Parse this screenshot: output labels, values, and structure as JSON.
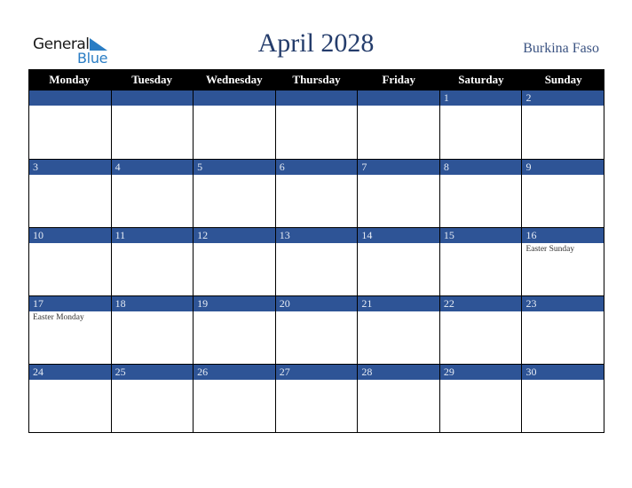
{
  "logo": {
    "word1": "General",
    "word2": "Blue",
    "icon": "triangle-flag-icon"
  },
  "header": {
    "title": "April 2028",
    "country": "Burkina Faso"
  },
  "colors": {
    "band": "#2e5496",
    "header_bg": "#000000",
    "title": "#243c6b",
    "logo_blue": "#2a7dc4"
  },
  "weekdays": [
    "Monday",
    "Tuesday",
    "Wednesday",
    "Thursday",
    "Friday",
    "Saturday",
    "Sunday"
  ],
  "weeks": [
    [
      {
        "day": ""
      },
      {
        "day": ""
      },
      {
        "day": ""
      },
      {
        "day": ""
      },
      {
        "day": ""
      },
      {
        "day": "1"
      },
      {
        "day": "2"
      }
    ],
    [
      {
        "day": "3"
      },
      {
        "day": "4"
      },
      {
        "day": "5"
      },
      {
        "day": "6"
      },
      {
        "day": "7"
      },
      {
        "day": "8"
      },
      {
        "day": "9"
      }
    ],
    [
      {
        "day": "10"
      },
      {
        "day": "11"
      },
      {
        "day": "12"
      },
      {
        "day": "13"
      },
      {
        "day": "14"
      },
      {
        "day": "15"
      },
      {
        "day": "16",
        "event": "Easter Sunday"
      }
    ],
    [
      {
        "day": "17",
        "event": "Easter Monday"
      },
      {
        "day": "18"
      },
      {
        "day": "19"
      },
      {
        "day": "20"
      },
      {
        "day": "21"
      },
      {
        "day": "22"
      },
      {
        "day": "23"
      }
    ],
    [
      {
        "day": "24"
      },
      {
        "day": "25"
      },
      {
        "day": "26"
      },
      {
        "day": "27"
      },
      {
        "day": "28"
      },
      {
        "day": "29"
      },
      {
        "day": "30"
      }
    ]
  ]
}
